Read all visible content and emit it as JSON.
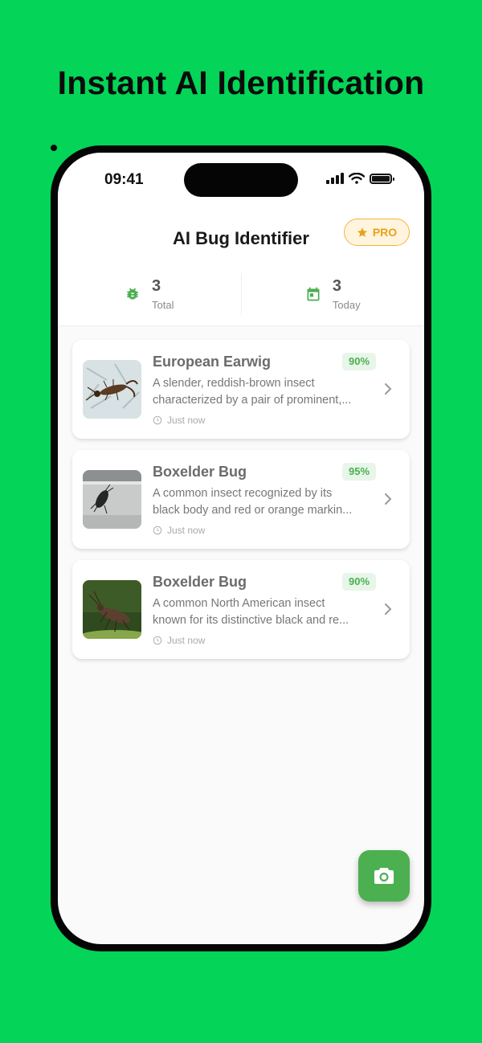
{
  "headline": "Instant AI Identification",
  "status_bar": {
    "time": "09:41"
  },
  "header": {
    "title": "AI Bug Identifier",
    "pro_label": "PRO"
  },
  "stats": [
    {
      "value": "3",
      "label": "Total",
      "icon": "bug-icon"
    },
    {
      "value": "3",
      "label": "Today",
      "icon": "calendar-icon"
    }
  ],
  "cards": [
    {
      "title": "European Earwig",
      "confidence": "90%",
      "desc_line1": "A slender, reddish-brown insect",
      "desc_line2": "characterized by a pair of prominent,...",
      "time": "Just now"
    },
    {
      "title": "Boxelder Bug",
      "confidence": "95%",
      "desc_line1": "A common insect recognized by its",
      "desc_line2": "black body and red or orange markin...",
      "time": "Just now"
    },
    {
      "title": "Boxelder Bug",
      "confidence": "90%",
      "desc_line1": "A common North American insect",
      "desc_line2": "known for its distinctive black and re...",
      "time": "Just now"
    }
  ],
  "colors": {
    "background": "#04D457",
    "accent": "#4CAF50",
    "pro": "#E8A219"
  },
  "fab": {
    "icon": "camera-icon"
  }
}
